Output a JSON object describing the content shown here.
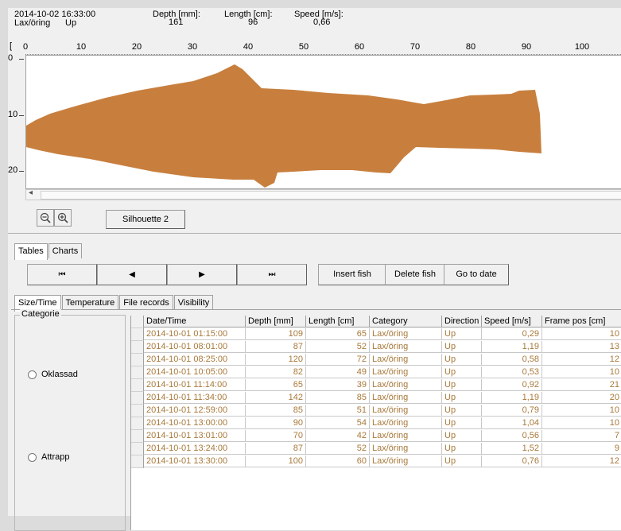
{
  "header": {
    "datetime": "2014-10-02 16:33:00",
    "species": "Lax/öring",
    "direction": "Up",
    "depth_label": "Depth [mm]:",
    "depth_value": "161",
    "length_label": "Length [cm]:",
    "length_value": "96",
    "speed_label": "Speed [m/s]:",
    "speed_value": "0,66"
  },
  "ruler": {
    "bracket": "[",
    "ticks": [
      "0",
      "10",
      "20",
      "30",
      "40",
      "50",
      "60",
      "70",
      "80",
      "90",
      "100"
    ]
  },
  "plot": {
    "y_labels": [
      "0",
      "10",
      "20"
    ],
    "fill_color": "#c87f3e"
  },
  "controls": {
    "zoom_out": "zoom-out",
    "zoom_in": "zoom-in",
    "silhouette_button": "Silhouette 2"
  },
  "tabs_main": [
    "Tables",
    "Charts"
  ],
  "nav": {
    "first": "⏮",
    "prev": "◀",
    "next": "▶",
    "last": "⏭",
    "insert_fish": "Insert fish",
    "delete_fish": "Delete fish",
    "go_to_date": "Go to date"
  },
  "tabs_sub": [
    "Size/Time",
    "Temperature",
    "File records",
    "Visibility"
  ],
  "category_box": {
    "legend": "Categorie",
    "options": [
      "Oklassad",
      "Attrapp"
    ]
  },
  "table": {
    "columns": [
      "Date/Time",
      "Depth [mm]",
      "Length [cm]",
      "Category",
      "Direction",
      "Speed [m/s]",
      "Frame pos [cm]"
    ],
    "rows": [
      [
        "2014-10-01 01:15:00",
        "109",
        "65",
        "Lax/öring",
        "Up",
        "0,29",
        "10"
      ],
      [
        "2014-10-01 08:01:00",
        "87",
        "52",
        "Lax/öring",
        "Up",
        "1,19",
        "13"
      ],
      [
        "2014-10-01 08:25:00",
        "120",
        "72",
        "Lax/öring",
        "Up",
        "0,58",
        "12"
      ],
      [
        "2014-10-01 10:05:00",
        "82",
        "49",
        "Lax/öring",
        "Up",
        "0,53",
        "10"
      ],
      [
        "2014-10-01 11:14:00",
        "65",
        "39",
        "Lax/öring",
        "Up",
        "0,92",
        "21"
      ],
      [
        "2014-10-01 11:34:00",
        "142",
        "85",
        "Lax/öring",
        "Up",
        "1,19",
        "20"
      ],
      [
        "2014-10-01 12:59:00",
        "85",
        "51",
        "Lax/öring",
        "Up",
        "0,79",
        "10"
      ],
      [
        "2014-10-01 13:00:00",
        "90",
        "54",
        "Lax/öring",
        "Up",
        "1,04",
        "10"
      ],
      [
        "2014-10-01 13:01:00",
        "70",
        "42",
        "Lax/öring",
        "Up",
        "0,56",
        "7"
      ],
      [
        "2014-10-01 13:24:00",
        "87",
        "52",
        "Lax/öring",
        "Up",
        "1,52",
        "9"
      ],
      [
        "2014-10-01 13:30:00",
        "100",
        "60",
        "Lax/öring",
        "Up",
        "0,76",
        "12"
      ]
    ]
  }
}
